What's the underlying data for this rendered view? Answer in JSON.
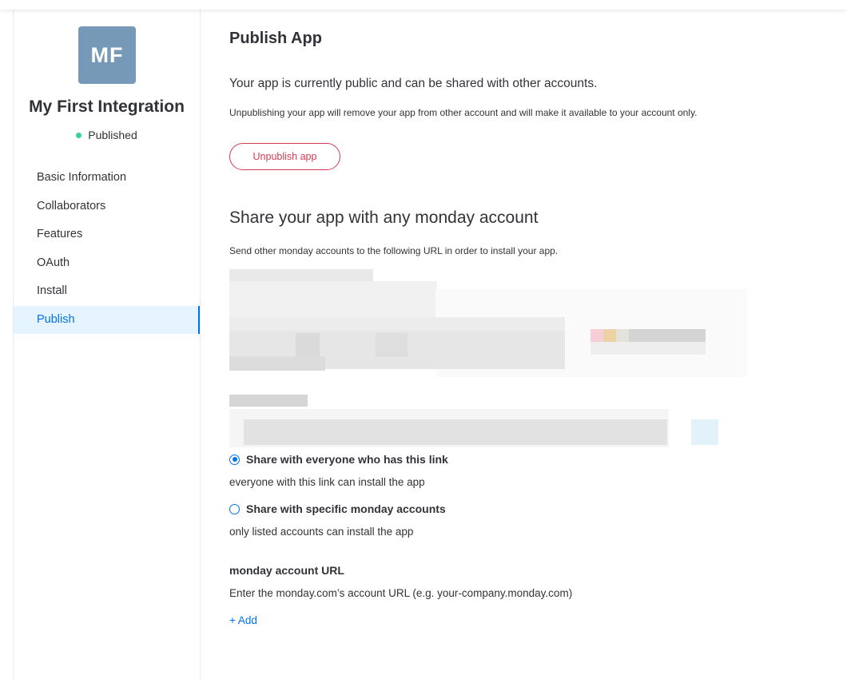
{
  "sidebar": {
    "avatar_initials": "MF",
    "avatar_color": "#7699b7",
    "app_name": "My First Integration",
    "status": "Published",
    "status_color": "#33d391",
    "nav": [
      {
        "label": "Basic Information",
        "active": false
      },
      {
        "label": "Collaborators",
        "active": false
      },
      {
        "label": "Features",
        "active": false
      },
      {
        "label": "OAuth",
        "active": false
      },
      {
        "label": "Install",
        "active": false
      },
      {
        "label": "Publish",
        "active": true
      }
    ]
  },
  "main": {
    "title": "Publish App",
    "public_notice": "Your app is currently public and can be shared with other accounts.",
    "unpublish_note": "Unpublishing your app will remove your app from other account and will make it available to your account only.",
    "unpublish_button": "Unpublish app",
    "share_heading": "Share your app with any monday account",
    "share_desc": "Send other monday accounts to the following URL in order to install your app.",
    "share_options": [
      {
        "label": "Share with everyone who has this link",
        "desc": "everyone with this link can install the app",
        "checked": true
      },
      {
        "label": "Share with specific monday accounts",
        "desc": "only listed accounts can install the app",
        "checked": false
      }
    ],
    "account_url_label": "monday account URL",
    "account_url_desc": "Enter the monday.com’s account URL (e.g. your-company.monday.com)",
    "add_link": "+ Add"
  },
  "colors": {
    "accent": "#0073ea",
    "danger": "#d83a52",
    "active_nav_bg": "#e5f4ff"
  }
}
